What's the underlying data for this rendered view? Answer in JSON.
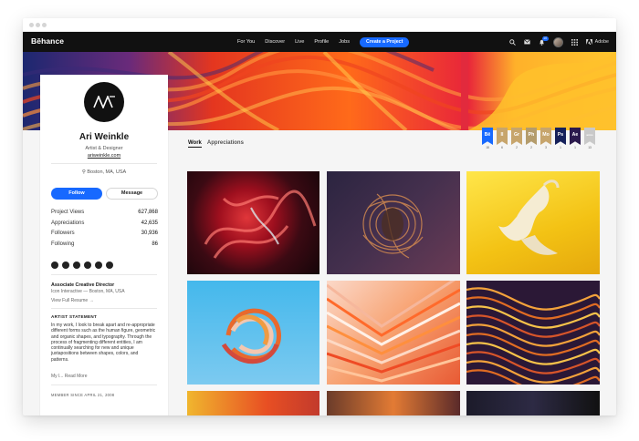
{
  "app": {
    "logo": "Bēhance"
  },
  "nav": {
    "links": [
      "For You",
      "Discover",
      "Live",
      "Profile",
      "Jobs"
    ],
    "create_label": "Create a Project",
    "notification_count": "10",
    "adobe_label": "Adobe"
  },
  "profile": {
    "name": "Ari Weinkle",
    "role": "Artist & Designer",
    "website": "ariweinkle.com",
    "location": "Boston, MA, USA",
    "follow_label": "Follow",
    "message_label": "Message",
    "stats": [
      {
        "label": "Project Views",
        "value": "627,868"
      },
      {
        "label": "Appreciations",
        "value": "42,635"
      },
      {
        "label": "Followers",
        "value": "30,936"
      },
      {
        "label": "Following",
        "value": "86"
      }
    ],
    "social_icons": [
      "twitter-icon",
      "instagram-icon",
      "dribbble-icon",
      "linkedin-icon",
      "vimeo-icon",
      "pinterest-icon"
    ],
    "job_title": "Associate Creative Director",
    "job_company": "Icon Interactive — Boston, MA, USA",
    "resume_label": "View Full Resume",
    "artist_statement_heading": "ARTIST STATEMENT",
    "artist_statement": "In my work, I look to break apart and re-appropriate different forms such as the human figure, geometric and organic shapes, and typography. Through the process of fragmenting different entities, I am continually searching for new and unique juxtapositions between shapes, colors, and patterns.",
    "read_more_prefix": "My l...",
    "read_more_label": "Read More",
    "member_since": "MEMBER SINCE APRIL 21, 2008"
  },
  "tabs": {
    "work": "Work",
    "appreciations": "Appreciations"
  },
  "awards": [
    {
      "abbr": "Bē",
      "count": "18",
      "color": "#1769ff"
    },
    {
      "abbr": "Il",
      "count": "6",
      "color": "#c7a56c"
    },
    {
      "abbr": "Gr",
      "count": "2",
      "color": "#c7a56c"
    },
    {
      "abbr": "Ph",
      "count": "2",
      "color": "#b49c6c"
    },
    {
      "abbr": "Mo",
      "count": "3",
      "color": "#c7a56c"
    },
    {
      "abbr": "Ps",
      "count": "1",
      "color": "#16215b"
    },
    {
      "abbr": "Ae",
      "count": "1",
      "color": "#2b1a4d"
    },
    {
      "abbr": "anno",
      "count": "13",
      "color": "#c9c9c9"
    }
  ],
  "projects": [
    {
      "name": "red-glossy-sculpture"
    },
    {
      "name": "copper-fractal-bloom"
    },
    {
      "name": "cream-figure-on-yellow"
    },
    {
      "name": "swirling-ribbon-on-blue"
    },
    {
      "name": "folded-paper-fan"
    },
    {
      "name": "warped-stripe-pattern"
    },
    {
      "name": "partial-tile-1"
    },
    {
      "name": "partial-tile-2"
    },
    {
      "name": "partial-tile-3"
    }
  ]
}
